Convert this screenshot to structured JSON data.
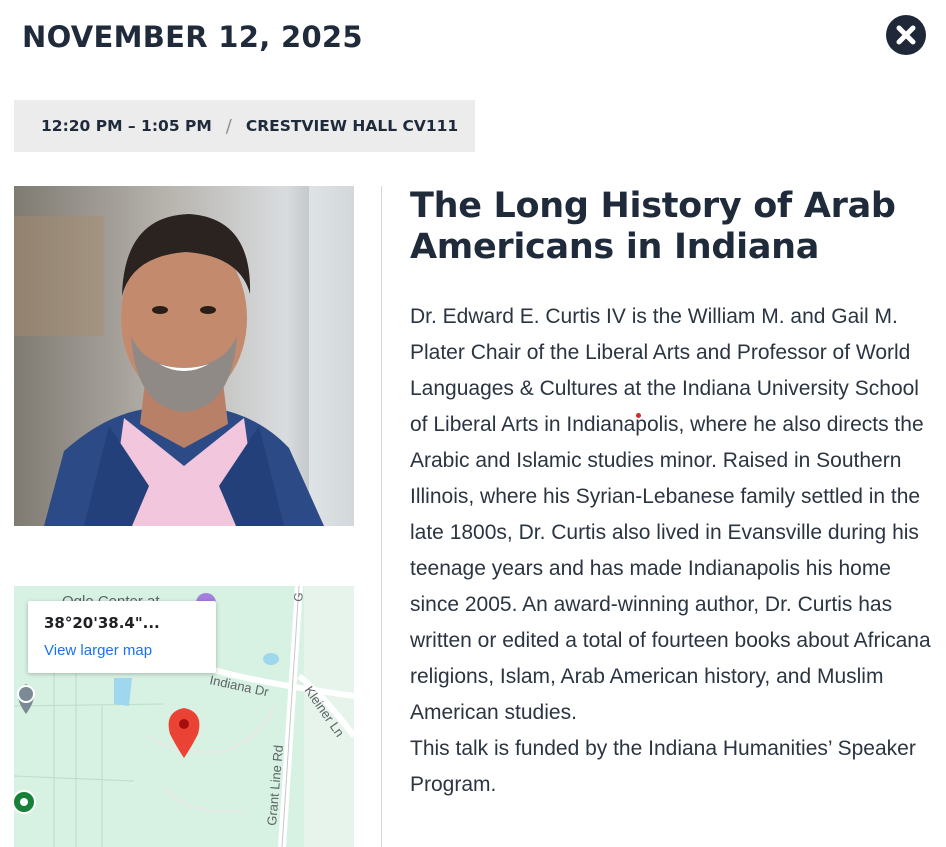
{
  "header": {
    "date": "NOVEMBER 12, 2025",
    "close_icon": "close-icon"
  },
  "meta": {
    "time": "12:20 PM – 1:05 PM",
    "separator": "/",
    "location": "CRESTVIEW HALL CV111"
  },
  "event": {
    "title_line1": "The Long History of Arab",
    "title_line2": "Americans in Indiana",
    "paragraph1": "Dr. Edward E. Curtis IV is the William M. and Gail M. Plater Chair of the Liberal Arts and Professor of World Languages & Cultures at the Indiana University School of Liberal Arts in Indianapolis, where he also directs the Arabic and Islamic studies minor.  Raised in Southern Illinois, where his Syrian-Lebanese family settled in the late 1800s, Dr. Curtis also lived in Evansville during his teenage years and has made Indianapolis his home since 2005.  An award-winning author, Dr. Curtis has written or edited a total of fourteen books about Africana religions, Islam, Arab American history, and Muslim American studies.",
    "paragraph2": "This talk is funded by the Indiana Humanities’ Speaker Program."
  },
  "map": {
    "coordinates": "38°20'38.4\"...",
    "larger_map_link": "View larger map",
    "labels": {
      "top_place": "Ogle Center at",
      "road_indiana": "Indiana Dr",
      "road_kleiner": "Kleiner Ln",
      "road_grant": "Grant Line Rd",
      "road_g": "G"
    },
    "colors": {
      "background": "#cfeedd",
      "water": "#9ed7ee",
      "pin": "#ea4335",
      "marker_green": "#188038"
    }
  }
}
